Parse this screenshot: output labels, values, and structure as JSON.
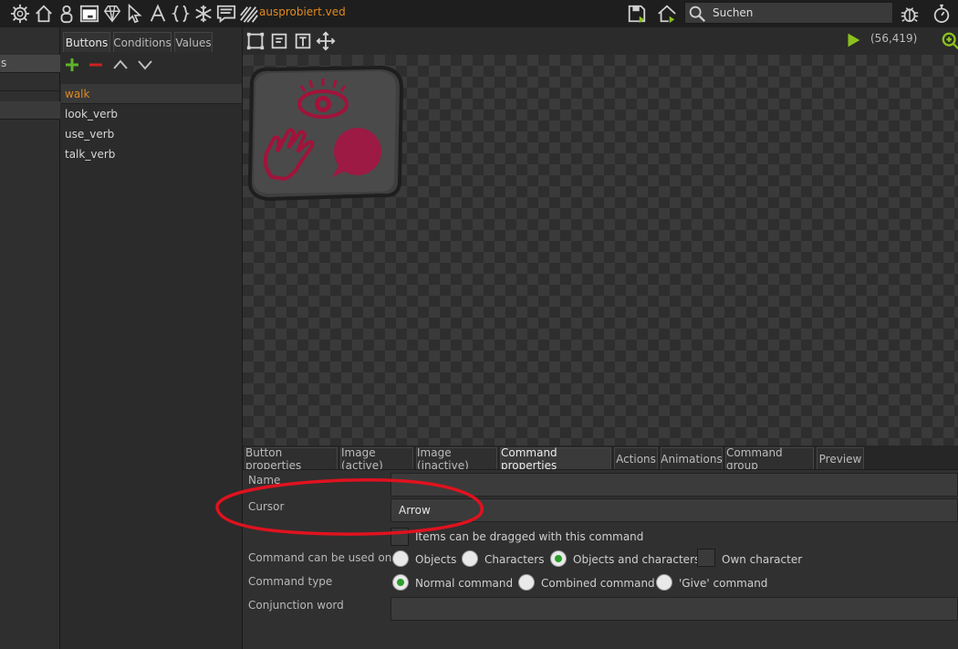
{
  "topbar": {
    "icons": [
      "gear-icon",
      "home-icon",
      "character-icon",
      "dialog-icon",
      "diamond-icon",
      "cursor-icon",
      "font-icon",
      "braces-icon",
      "snowflake-icon",
      "comment-icon",
      "stripes-icon"
    ],
    "project_name": "ausprobiert.ved",
    "search_label": "Suchen",
    "right_icons": [
      "save-icon",
      "home-export-icon",
      "bug-icon",
      "stopwatch-icon"
    ]
  },
  "left_panel": {
    "row_label": "s"
  },
  "list_panel": {
    "tabs": [
      "Buttons",
      "Conditions",
      "Values"
    ],
    "active_tab": "Buttons",
    "tools": [
      "add-icon",
      "remove-icon",
      "up-icon",
      "down-icon"
    ],
    "items": [
      "walk",
      "look_verb",
      "use_verb",
      "talk_verb"
    ],
    "selected": "walk"
  },
  "editor_toolbar": {
    "tools": [
      "select-rect-icon",
      "text-box-icon",
      "text-tool-icon",
      "move-icon"
    ],
    "coords": "(56,419)"
  },
  "bottom_tabs": {
    "tabs": [
      "Button properties",
      "Image (active)",
      "Image (inactive)",
      "Command properties",
      "Actions",
      "Animations",
      "Command group",
      "Preview"
    ],
    "active": "Command properties"
  },
  "properties": {
    "name_label": "Name",
    "name_value": "",
    "cursor_label": "Cursor",
    "cursor_value": "Arrow",
    "drag_label": "Items can be dragged with this command",
    "used_on_label": "Command can be used on",
    "used_on_options": [
      "Objects",
      "Characters",
      "Objects and characters"
    ],
    "used_on_selected": "Objects and characters",
    "own_character_label": "Own character",
    "type_label": "Command type",
    "type_options": [
      "Normal command",
      "Combined command",
      "'Give' command"
    ],
    "type_selected": "Normal command",
    "conjunction_label": "Conjunction word",
    "conjunction_value": ""
  },
  "colors": {
    "accent_orange": "#e08a1e",
    "green": "#2aa02a",
    "annotation_red": "#e0121f"
  }
}
